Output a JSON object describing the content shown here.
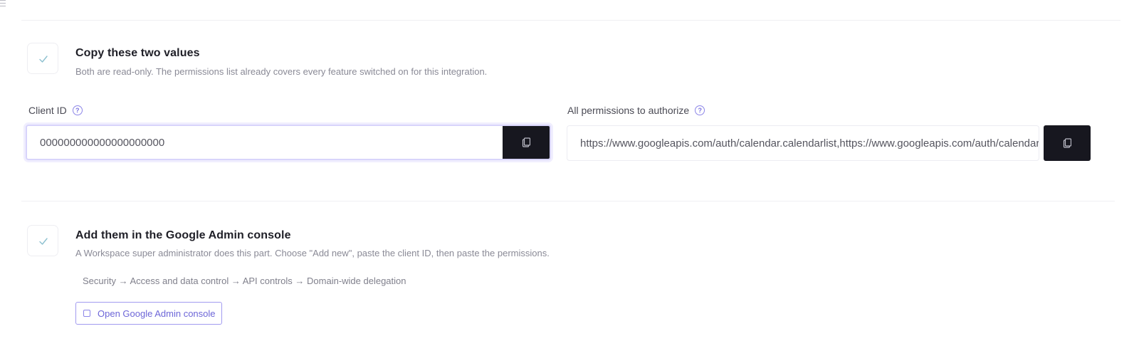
{
  "step1": {
    "title": "Copy these two values",
    "description": "Both are read-only. The permissions list already covers every feature switched on for this integration.",
    "check_icon": "check-icon"
  },
  "client_id": {
    "label": "Client ID",
    "help_glyph": "?",
    "value": "000000000000000000000",
    "copy_icon": "copy-icon"
  },
  "permissions": {
    "label": "All permissions to authorize",
    "help_glyph": "?",
    "value": "https://www.googleapis.com/auth/calendar.calendarlist,https://www.googleapis.com/auth/calendar",
    "copy_icon": "copy-icon"
  },
  "step2": {
    "title": "Add them in the Google Admin console",
    "description": "A Workspace super administrator does this part. Choose \"Add new\", paste the client ID, then paste the permissions.",
    "nav_path": "Security → Access and data control → API controls → Domain-wide delegation",
    "button_label": "Open Google Admin console",
    "button_icon": "external-link-icon",
    "check_icon": "check-icon"
  },
  "colors": {
    "accent": "#7a72e0",
    "copy_button": "#17171f",
    "check": "#7fb3c4"
  }
}
